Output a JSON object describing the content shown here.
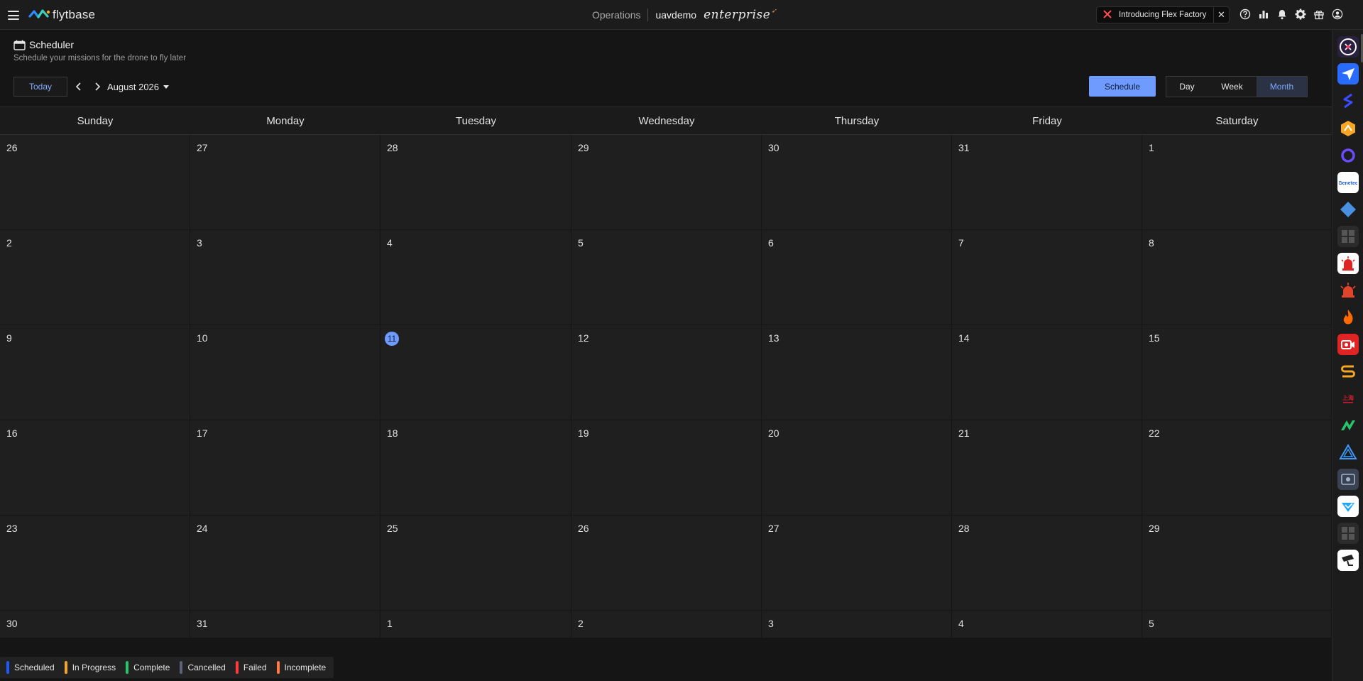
{
  "topbar": {
    "brand": "flytbase",
    "nav_section": "Operations",
    "org": "uavdemo",
    "plan": "enterprise",
    "promo_text": "Introducing Flex Factory",
    "icons": [
      "help-icon",
      "analytics-icon",
      "bell-icon",
      "gear-icon",
      "gift-icon",
      "user-icon"
    ]
  },
  "page": {
    "title": "Scheduler",
    "subtitle": "Schedule your missions for the drone to fly later"
  },
  "toolbar": {
    "today_label": "Today",
    "month_label": "August 2026",
    "schedule_label": "Schedule",
    "views": [
      {
        "label": "Day",
        "active": false
      },
      {
        "label": "Week",
        "active": false
      },
      {
        "label": "Month",
        "active": true
      }
    ]
  },
  "calendar": {
    "weekdays": [
      "Sunday",
      "Monday",
      "Tuesday",
      "Wednesday",
      "Thursday",
      "Friday",
      "Saturday"
    ],
    "weeks": [
      [
        "26",
        "27",
        "28",
        "29",
        "30",
        "31",
        "1"
      ],
      [
        "2",
        "3",
        "4",
        "5",
        "6",
        "7",
        "8"
      ],
      [
        "9",
        "10",
        "11",
        "12",
        "13",
        "14",
        "15"
      ],
      [
        "16",
        "17",
        "18",
        "19",
        "20",
        "21",
        "22"
      ],
      [
        "23",
        "24",
        "25",
        "26",
        "27",
        "28",
        "29"
      ],
      [
        "30",
        "31",
        "1",
        "2",
        "3",
        "4",
        "5"
      ]
    ],
    "today": "11"
  },
  "legend": [
    {
      "label": "Scheduled",
      "color": "#1e5bff"
    },
    {
      "label": "In Progress",
      "color": "#f5a623"
    },
    {
      "label": "Complete",
      "color": "#27c46b"
    },
    {
      "label": "Cancelled",
      "color": "#5b6478"
    },
    {
      "label": "Failed",
      "color": "#ff3b3b"
    },
    {
      "label": "Incomplete",
      "color": "#ff7a45"
    }
  ],
  "rail_apps": [
    {
      "name": "drone-app-icon",
      "bg": "#2a2140",
      "color": "#ffffff"
    },
    {
      "name": "send-app-icon",
      "bg": "#2a6bff",
      "color": "#ffffff"
    },
    {
      "name": "blue-s-app-icon",
      "bg": "#1c1c1c",
      "color": "#3a4dff"
    },
    {
      "name": "orange-hex-app-icon",
      "bg": "#1c1c1c",
      "color": "#f5a623"
    },
    {
      "name": "ring-app-icon",
      "bg": "#1c1c1c",
      "color": "#6a4bff"
    },
    {
      "name": "genetec-app-icon",
      "bg": "#ffffff",
      "color": "#1e5bd6"
    },
    {
      "name": "diamond-app-icon",
      "bg": "#1c1c1c",
      "color": "#4a90e2"
    },
    {
      "name": "grid-app-icon",
      "bg": "#2b2b2b",
      "color": "#555555"
    },
    {
      "name": "siren-app-icon",
      "bg": "#ffffff",
      "color": "#e02424"
    },
    {
      "name": "alarm-app-icon",
      "bg": "#1c1c1c",
      "color": "#e0442a"
    },
    {
      "name": "flame-app-icon",
      "bg": "#1c1c1c",
      "color": "#ff6a00"
    },
    {
      "name": "camera-app-icon",
      "bg": "#e02424",
      "color": "#ffffff"
    },
    {
      "name": "s-logo-app-icon",
      "bg": "#1c1c1c",
      "color": "#f5a623"
    },
    {
      "name": "brand-red-app-icon",
      "bg": "#1c1c1c",
      "color": "#d01c2c"
    },
    {
      "name": "green-a-app-icon",
      "bg": "#1c1c1c",
      "color": "#27c46b"
    },
    {
      "name": "triangle-app-icon",
      "bg": "#1c1c1c",
      "color": "#3a9bff"
    },
    {
      "name": "dark-device-app-icon",
      "bg": "#3a4252",
      "color": "#9fb3cc"
    },
    {
      "name": "blue-check-app-icon",
      "bg": "#ffffff",
      "color": "#1ea7ff"
    },
    {
      "name": "grid-app-icon-2",
      "bg": "#2b2b2b",
      "color": "#555555"
    },
    {
      "name": "cctv-app-icon",
      "bg": "#ffffff",
      "color": "#222222"
    }
  ]
}
